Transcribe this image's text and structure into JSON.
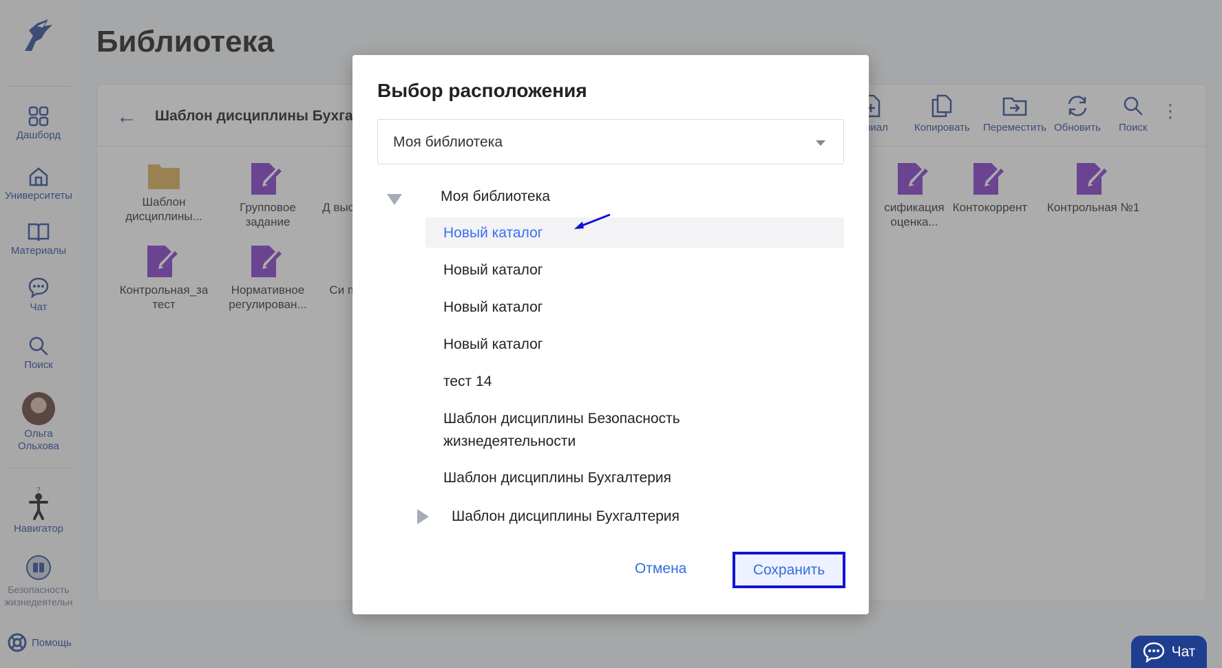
{
  "page": {
    "title": "Библиотека"
  },
  "sidebar": {
    "items": [
      {
        "label": "Дашборд",
        "icon": "grid-icon"
      },
      {
        "label": "Университеты",
        "icon": "home-icon"
      },
      {
        "label": "Материалы",
        "icon": "book-icon"
      },
      {
        "label": "Чат",
        "icon": "chat-icon"
      },
      {
        "label": "Поиск",
        "icon": "search-icon"
      }
    ],
    "user": {
      "name": "Ольга Ольхова"
    },
    "navigator": {
      "label": "Навигатор"
    },
    "course": {
      "label": "Безопасность жизнедеятельн"
    },
    "help": {
      "label": "Помощь"
    }
  },
  "panel": {
    "breadcrumb": "Шаблон дисциплины Бухга",
    "toolbar": [
      {
        "label": "териал",
        "icon": "file-plus-icon"
      },
      {
        "label": "Копировать",
        "icon": "copy-icon"
      },
      {
        "label": "Переместить",
        "icon": "folder-move-icon"
      },
      {
        "label": "Обновить",
        "icon": "refresh-icon"
      },
      {
        "label": "Поиск",
        "icon": "search-icon"
      }
    ],
    "tiles": [
      {
        "label": "Шаблон дисциплины...",
        "icon": "folder-icon"
      },
      {
        "label": "Групповое задание",
        "icon": "assignment-icon"
      },
      {
        "label": "Д выст",
        "icon": "assignment-icon"
      },
      {
        "label": "сификация оценка...",
        "icon": "assignment-icon"
      },
      {
        "label": "Контокоррент",
        "icon": "assignment-icon"
      },
      {
        "label": "Контрольная №1",
        "icon": "assignment-icon"
      },
      {
        "label": "Контрольная_за тест",
        "icon": "assignment-icon"
      },
      {
        "label": "Нормативное регулирован...",
        "icon": "assignment-icon"
      },
      {
        "label": "Си пр",
        "icon": "assignment-icon"
      }
    ]
  },
  "modal": {
    "title": "Выбор расположения",
    "select_value": "Моя библиотека",
    "tree_root": "Моя библиотека",
    "tree_items": [
      {
        "label": "Новый каталог"
      },
      {
        "label": "Новый каталог"
      },
      {
        "label": "Новый каталог"
      },
      {
        "label": "Новый каталог"
      },
      {
        "label": "тест 14"
      },
      {
        "label": "Шаблон дисциплины Безопасность жизнедеятельности"
      },
      {
        "label": "Шаблон дисциплины Бухгалтерия"
      },
      {
        "label": "Шаблон дисциплины Бухгалтерия"
      }
    ],
    "cancel_label": "Отмена",
    "save_label": "Сохранить"
  },
  "chat_fab": {
    "label": "Чат"
  },
  "colors": {
    "accent": "#1e3f91",
    "link": "#2f6fdc",
    "assignment": "#7a2fc8",
    "folder": "#d8a84a",
    "focus": "#1212d6"
  }
}
